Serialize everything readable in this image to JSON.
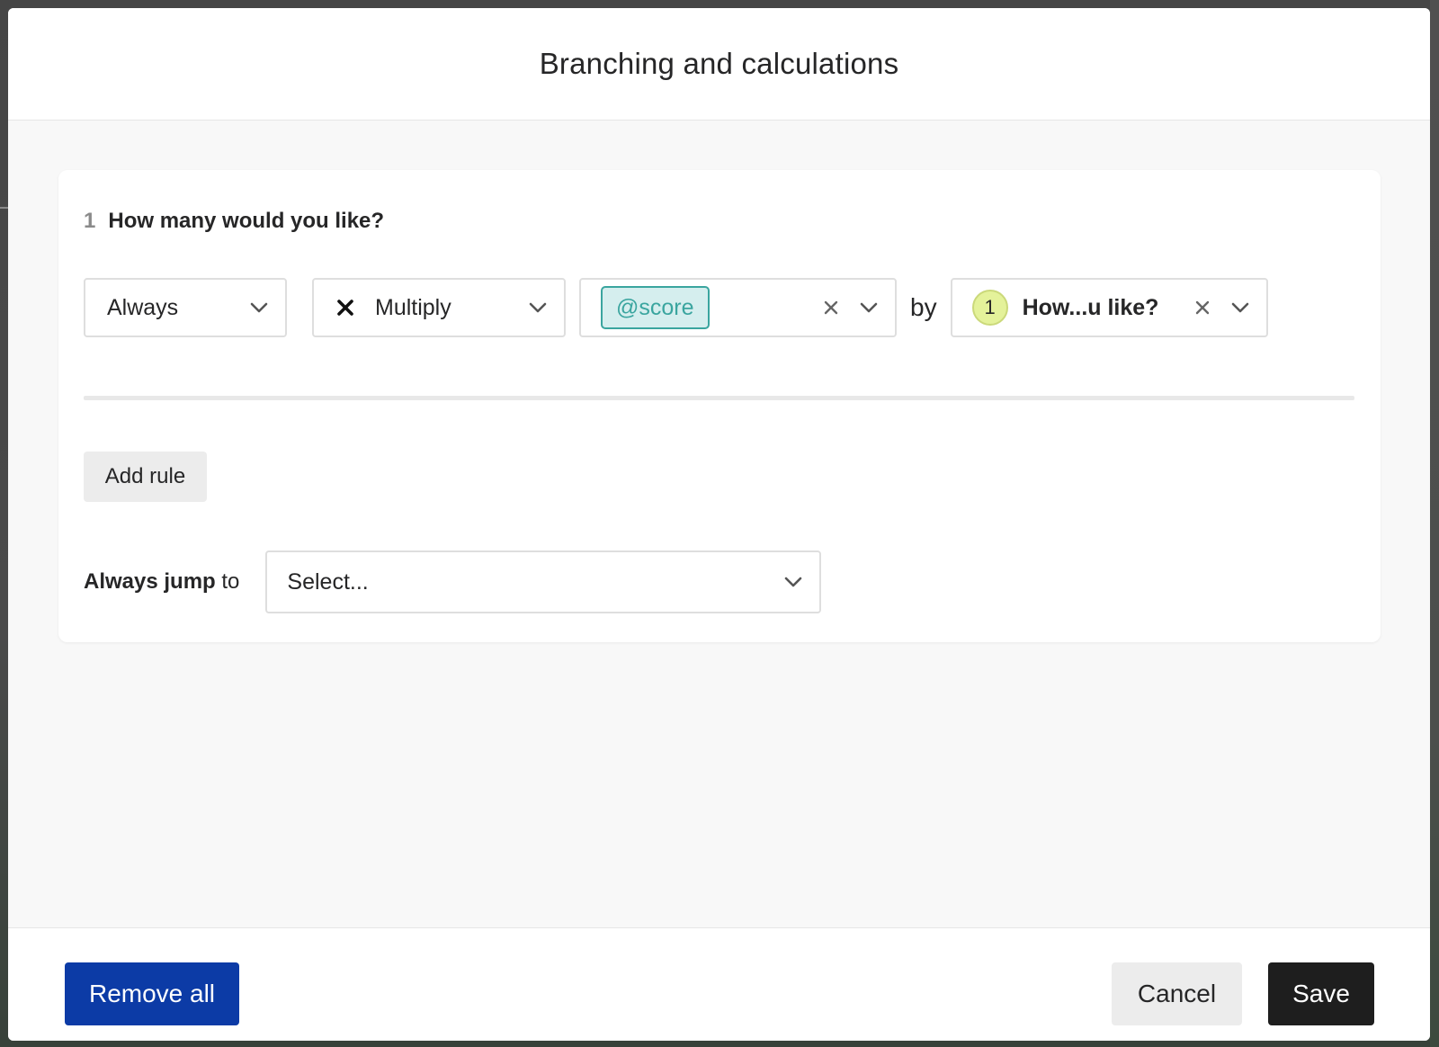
{
  "modal": {
    "title": "Branching and calculations"
  },
  "question": {
    "number": "1",
    "text": "How many would you like?"
  },
  "rule": {
    "condition": "Always",
    "operation": "Multiply",
    "operation_icon": "multiply-x-icon",
    "variable": "@score",
    "by_label": "by",
    "target_badge": "1",
    "target_text": "How...u like?"
  },
  "actions": {
    "add_rule_label": "Add rule"
  },
  "jump": {
    "label_bold": "Always jump",
    "label_rest": " to",
    "placeholder": "Select..."
  },
  "footer": {
    "remove_all_label": "Remove all",
    "cancel_label": "Cancel",
    "save_label": "Save"
  },
  "colors": {
    "primary_blue": "#0c3ba6",
    "save_dark": "#1e1e1e",
    "variable_teal": "#3aa59f",
    "variable_bg": "#d5eeee",
    "badge_yellow": "#e4f29a"
  }
}
